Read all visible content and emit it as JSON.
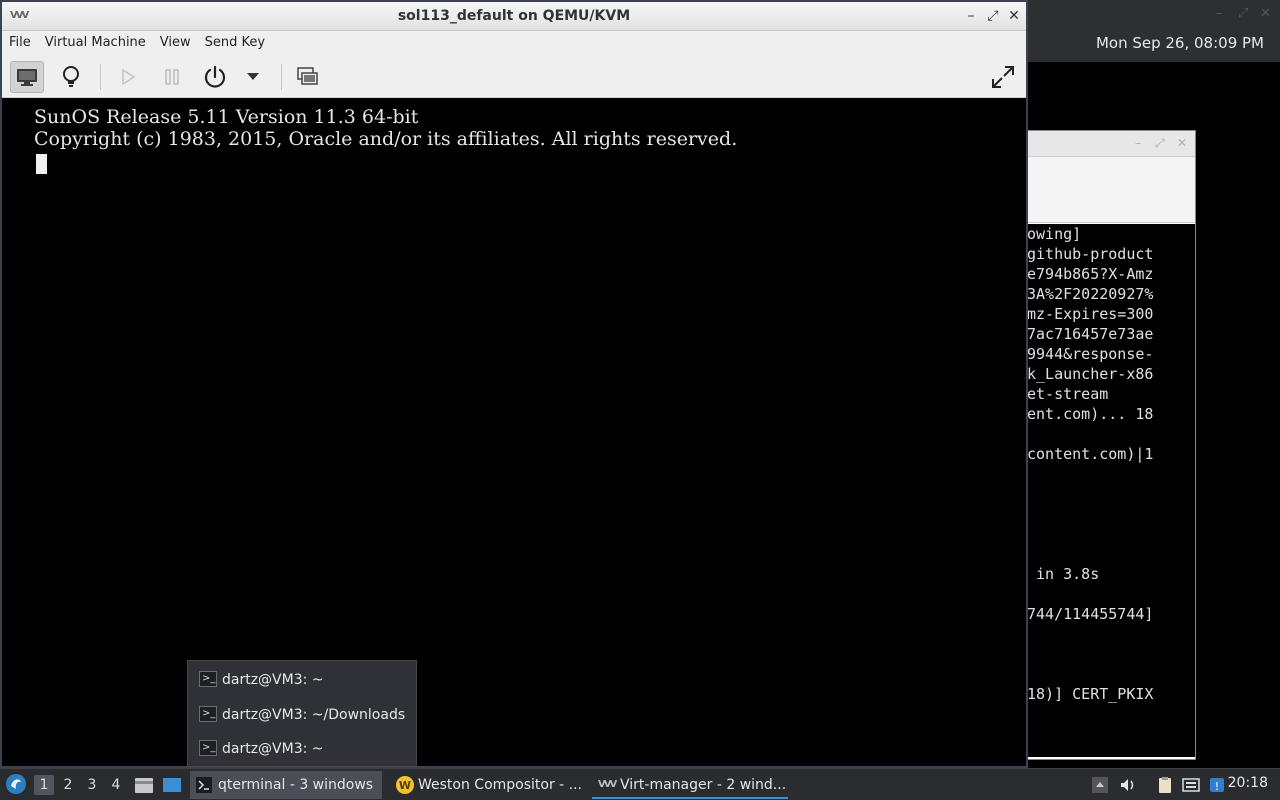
{
  "desktop": {
    "top_clock": "Mon Sep 26, 08:09 PM",
    "bg_terminal_lines": [
      "owing]",
      "github-product",
      "e794b865?X-Amz",
      "3A%2F20220927%",
      "mz-Expires=300",
      "7ac716457e73ae",
      "9944&response-",
      "k_Launcher-x86",
      "et-stream",
      "ent.com)... 18",
      "",
      "content.com)|1",
      "",
      "",
      "",
      "",
      "",
      " in 3.8s",
      "",
      "744/114455744]",
      "",
      "",
      "",
      "18)] CERT_PKIX"
    ]
  },
  "vm_window": {
    "title": "sol113_default on QEMU/KVM",
    "wm_buttons": {
      "minimize": "–",
      "maximize": "⤢",
      "close": "✕"
    },
    "menu": [
      "File",
      "Virtual Machine",
      "View",
      "Send Key"
    ],
    "toolbar": {
      "console_icon": "monitor-icon",
      "details_icon": "lightbulb-icon",
      "run_icon": "play-icon",
      "pause_icon": "pause-icon",
      "power_icon": "power-icon",
      "power_menu_icon": "chevron-down-icon",
      "snapshot_icon": "snapshot-icon",
      "fullscreen_icon": "fullscreen-icon"
    },
    "console_lines": [
      "SunOS Release 5.11 Version 11.3 64-bit",
      "Copyright (c) 1983, 2015, Oracle and/or its affiliates. All rights reserved."
    ]
  },
  "popup": {
    "items": [
      "dartz@VM3: ~",
      "dartz@VM3: ~/Downloads",
      "dartz@VM3: ~"
    ]
  },
  "taskbar": {
    "workspaces": [
      "1",
      "2",
      "3",
      "4"
    ],
    "tasks": [
      {
        "label": "qterminal - 3 windows"
      },
      {
        "label": "Weston Compositor - ..."
      },
      {
        "label": "Virt-manager - 2 wind..."
      }
    ],
    "clock": "20:18"
  }
}
